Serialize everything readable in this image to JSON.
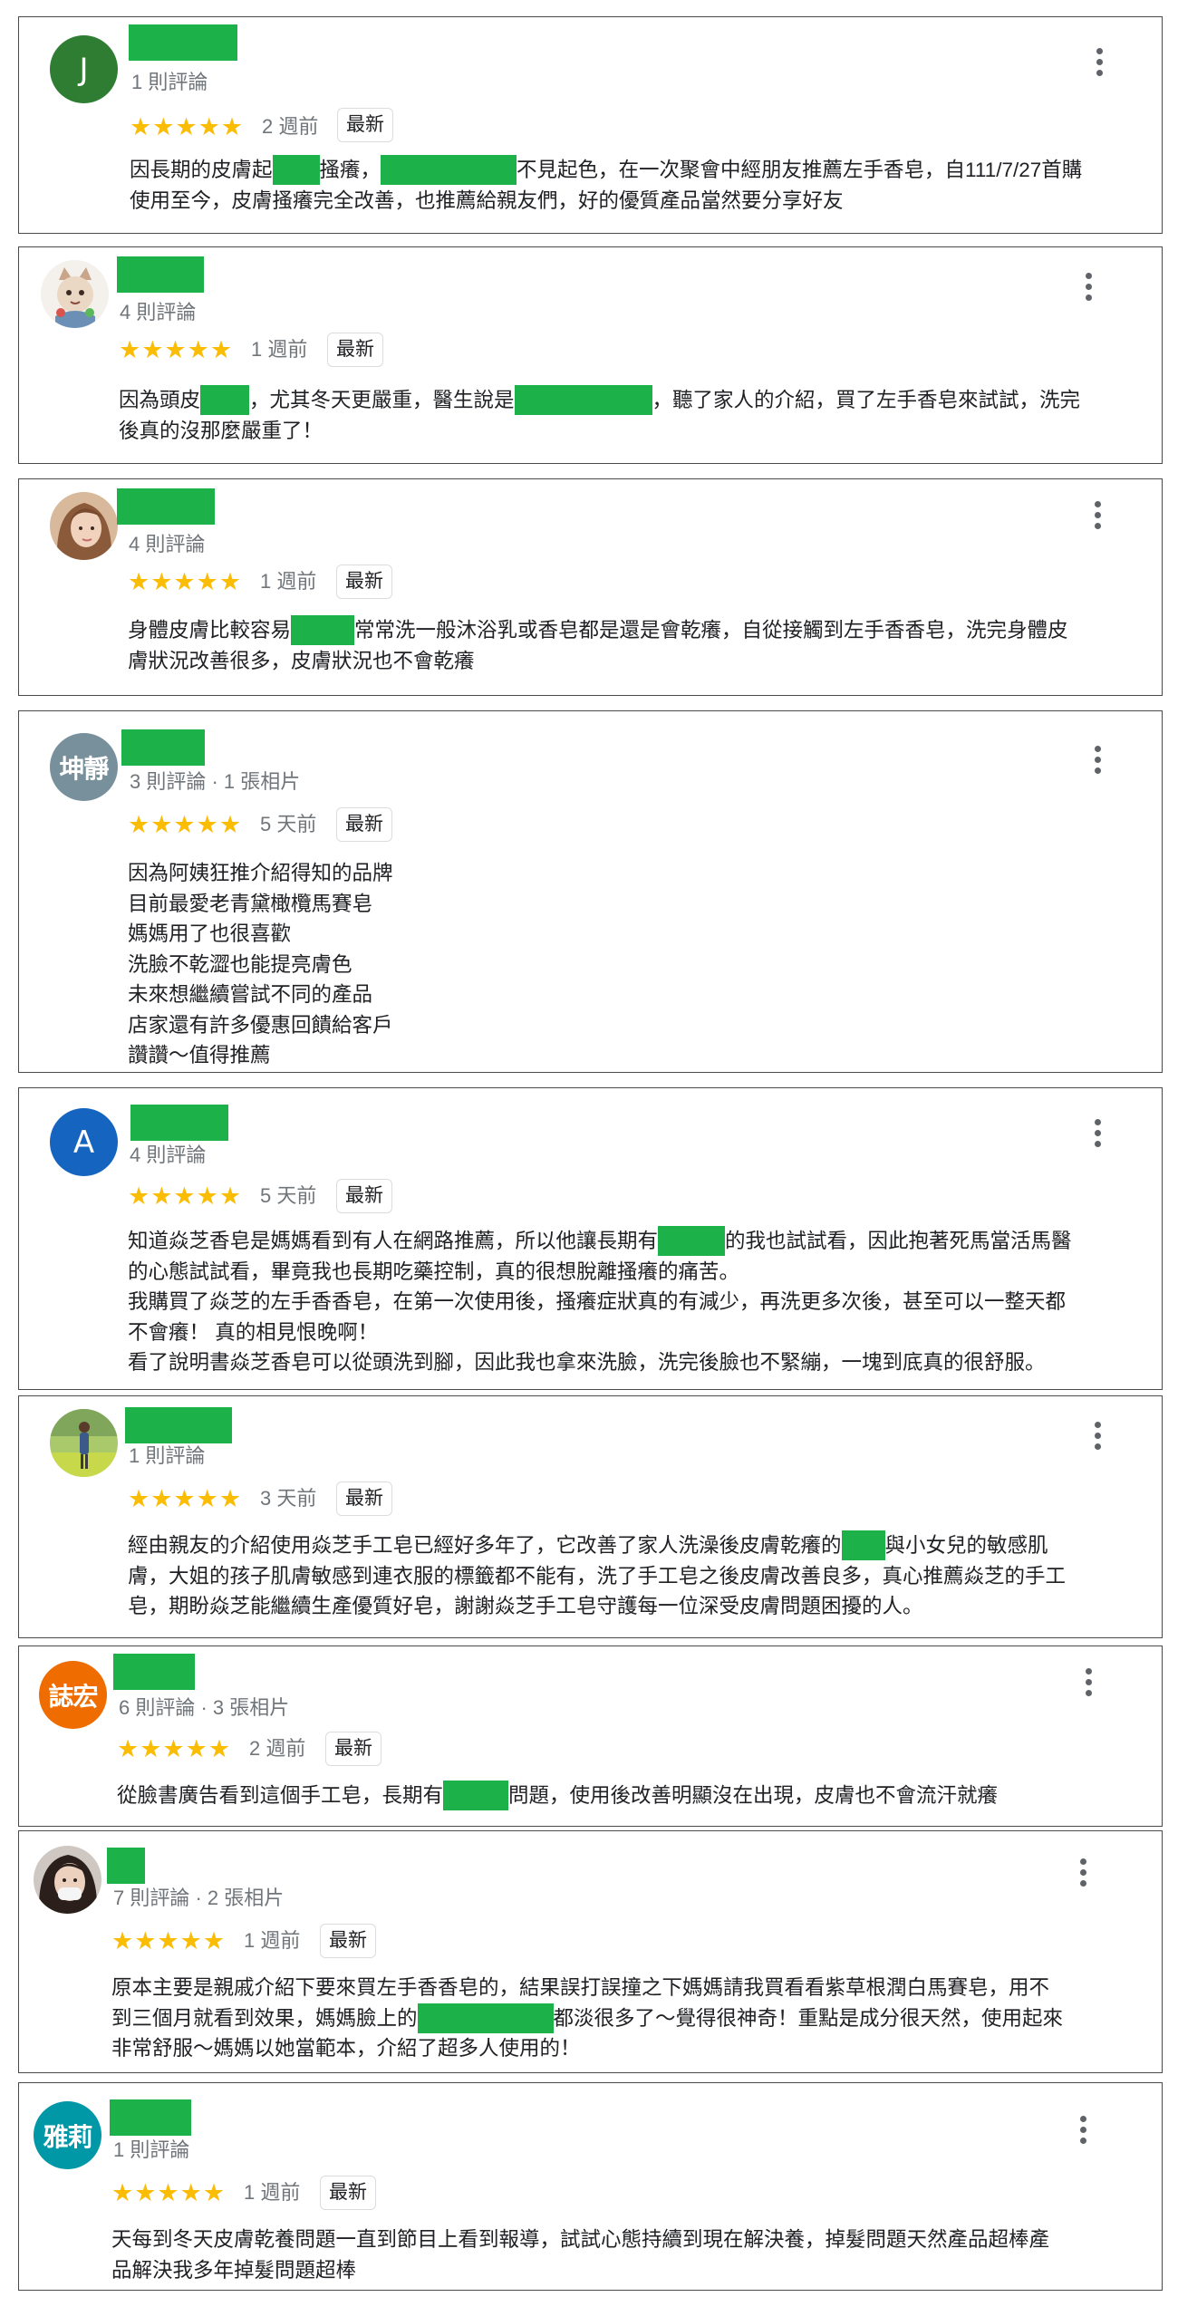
{
  "ui": {
    "badge_label": "最新",
    "star_glyphs": "★★★★★",
    "rating": 5,
    "accent_color": "#1db249",
    "star_color": "#fbbc04"
  },
  "reviews": [
    {
      "avatar": {
        "type": "letter",
        "text": "J",
        "color": "#2e7d32"
      },
      "meta": "1 則評論",
      "time": "2 週前",
      "lines": [
        [
          "因長期的皮膚起",
          {
            "redacted": true
          },
          "搔癢，",
          {
            "redacted": true
          },
          "不見起色，在一次聚會中經朋友推薦左手香皂，自111/7/27首購"
        ],
        [
          "使用至今，皮膚搔癢完全改善，也推薦給親友們，好的優質產品當然要分享好友"
        ]
      ]
    },
    {
      "avatar": {
        "type": "photo",
        "icon": "cat-figure-avatar"
      },
      "meta": "4 則評論",
      "time": "1 週前",
      "lines": [
        [
          "因為頭皮",
          {
            "redacted": true
          },
          "，尤其冬天更嚴重，醫生說是",
          {
            "redacted": true
          },
          "，聽了家人的介紹，買了左手香皂來試試，洗完"
        ],
        [
          "後真的沒那麼嚴重了！"
        ]
      ]
    },
    {
      "avatar": {
        "type": "photo",
        "icon": "woman-portrait-avatar"
      },
      "meta": "4 則評論",
      "time": "1 週前",
      "lines": [
        [
          "身體皮膚比較容易",
          {
            "redacted": true
          },
          "常常洗一般沐浴乳或香皂都是還是會乾癢，自從接觸到左手香香皂，洗完身體皮"
        ],
        [
          "膚狀況改善很多，皮膚狀況也不會乾癢"
        ]
      ]
    },
    {
      "avatar": {
        "type": "cjk",
        "text": "坤靜",
        "color": "#78909c"
      },
      "meta": "3 則評論 · 1 張相片",
      "time": "5 天前",
      "lines": [
        [
          "因為阿姨狂推介紹得知的品牌"
        ],
        [
          "目前最愛老青黛橄欖馬賽皂"
        ],
        [
          "媽媽用了也很喜歡"
        ],
        [
          "洗臉不乾澀也能提亮膚色"
        ],
        [
          "未來想繼續嘗試不同的產品"
        ],
        [
          "店家還有許多優惠回饋給客戶"
        ],
        [
          "讚讚～值得推薦"
        ]
      ]
    },
    {
      "avatar": {
        "type": "letter",
        "text": "A",
        "color": "#1565c0"
      },
      "meta": "4 則評論",
      "time": "5 天前",
      "lines": [
        [
          "知道焱芝香皂是媽媽看到有人在網路推薦，所以他讓長期有",
          {
            "redacted": true
          },
          "的我也試試看，因此抱著死馬當活馬醫"
        ],
        [
          "的心態試試看，畢竟我也長期吃藥控制，真的很想脫離搔癢的痛苦。"
        ],
        [
          "我購買了焱芝的左手香香皂，在第一次使用後，搔癢症狀真的有減少，再洗更多次後，甚至可以一整天都"
        ],
        [
          "不會癢！ 真的相見恨晚啊！"
        ],
        [
          "看了說明書焱芝香皂可以從頭洗到腳，因此我也拿來洗臉，洗完後臉也不緊繃，一塊到底真的很舒服。"
        ]
      ]
    },
    {
      "avatar": {
        "type": "photo",
        "icon": "person-outdoor-avatar"
      },
      "meta": "1 則評論",
      "time": "3 天前",
      "lines": [
        [
          "經由親友的介紹使用焱芝手工皂已經好多年了，它改善了家人洗澡後皮膚乾癢的",
          {
            "redacted": true
          },
          "與小女兒的敏感肌"
        ],
        [
          "膚，大姐的孩子肌膚敏感到連衣服的標籤都不能有，洗了手工皂之後皮膚改善良多，真心推薦焱芝的手工"
        ],
        [
          "皂，期盼焱芝能繼續生產優質好皂，謝謝焱芝手工皂守護每一位深受皮膚問題困擾的人。"
        ]
      ]
    },
    {
      "avatar": {
        "type": "cjk",
        "text": "誌宏",
        "color": "#ef6c00"
      },
      "meta": "6 則評論 · 3 張相片",
      "time": "2 週前",
      "lines": [
        [
          "從臉書廣告看到這個手工皂，長期有",
          {
            "redacted": true
          },
          "問題，使用後改善明顯沒在出現，皮膚也不會流汗就癢"
        ]
      ]
    },
    {
      "avatar": {
        "type": "photo",
        "icon": "masked-woman-avatar"
      },
      "meta": "7 則評論 · 2 張相片",
      "time": "1 週前",
      "lines": [
        [
          "原本主要是親戚介紹下要來買左手香香皂的，結果誤打誤撞之下媽媽請我買看看紫草根潤白馬賽皂，用不"
        ],
        [
          "到三個月就看到效果，媽媽臉上的",
          {
            "redacted": true
          },
          "都淡很多了～覺得很神奇！重點是成分很天然，使用起來"
        ],
        [
          "非常舒服～媽媽以她當範本，介紹了超多人使用的！"
        ]
      ]
    },
    {
      "avatar": {
        "type": "cjk",
        "text": "雅莉",
        "color": "#0097a7"
      },
      "meta": "1 則評論",
      "time": "1 週前",
      "lines": [
        [
          "天每到冬天皮膚乾養問題一直到節目上看到報導，試試心態持續到現在解決養，掉髮問題天然產品超棒產"
        ],
        [
          "品解決我多年掉髮問題超棒"
        ]
      ]
    }
  ]
}
